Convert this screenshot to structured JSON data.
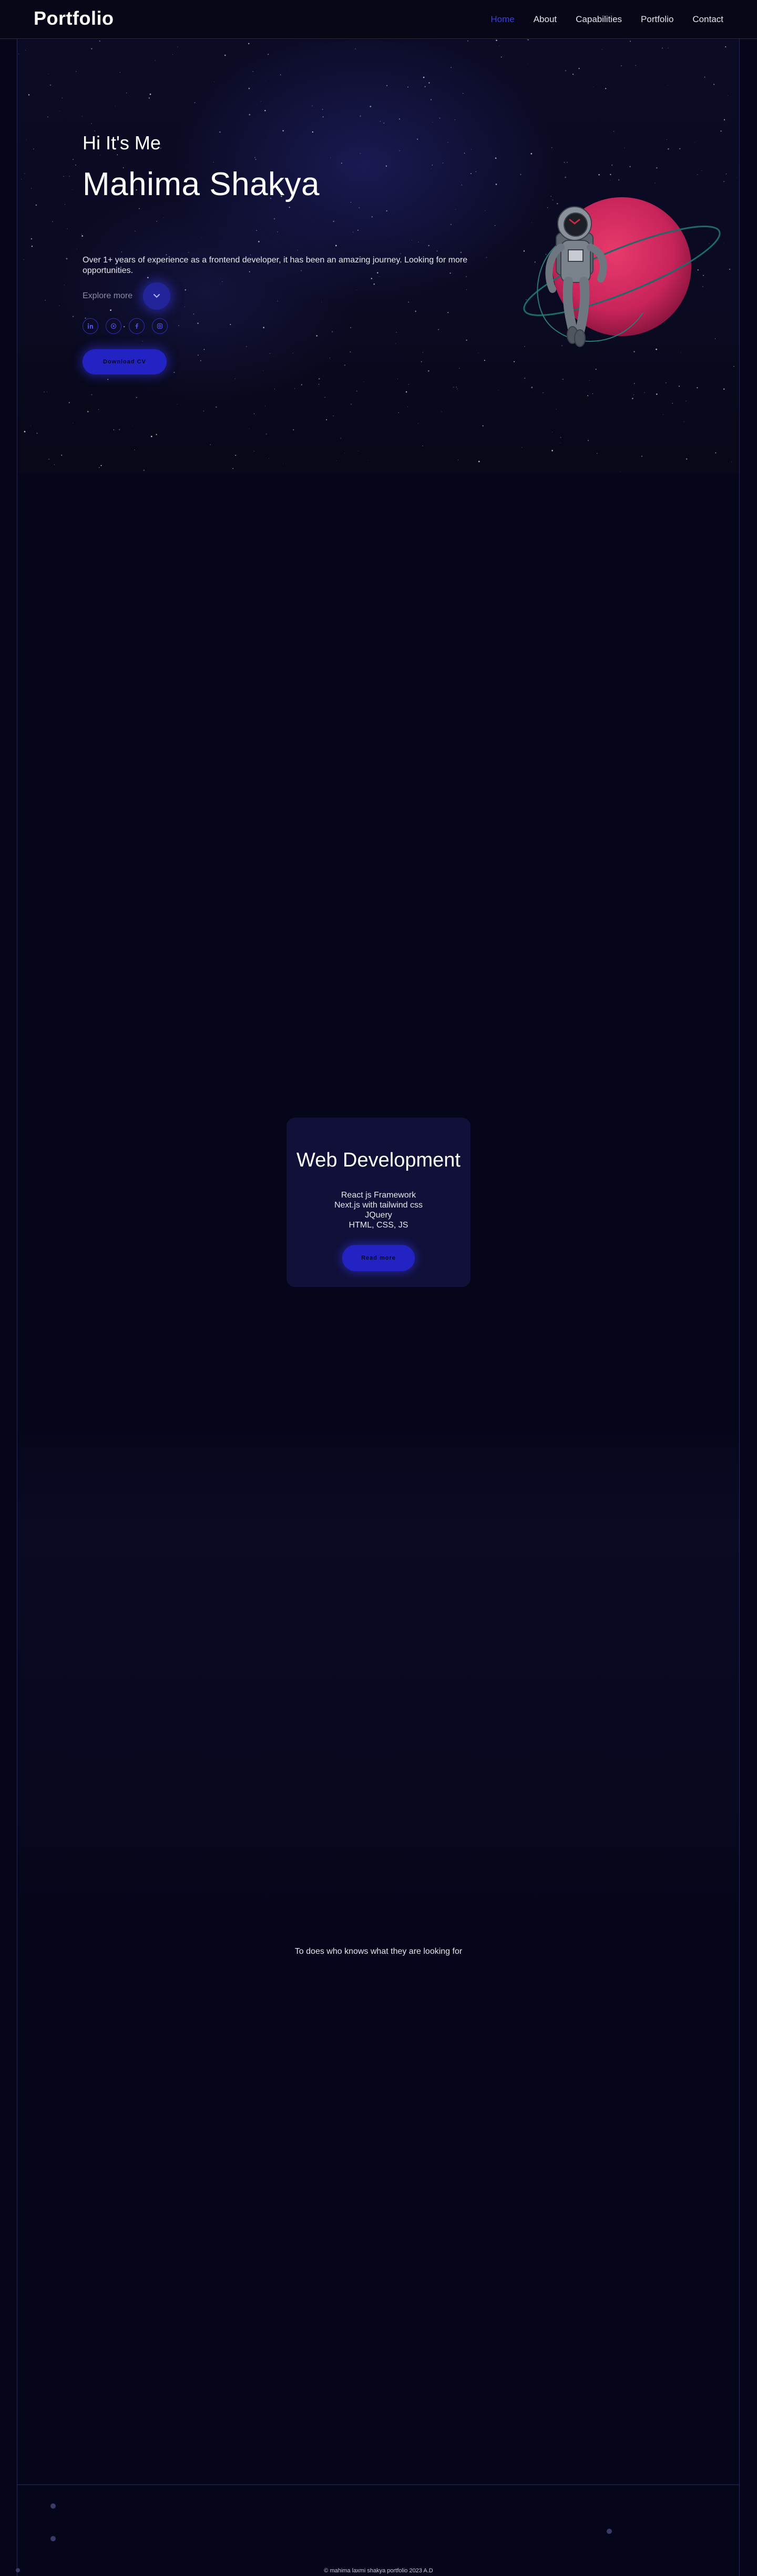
{
  "navbar": {
    "brand": "Portfolio",
    "links": [
      "Home",
      "About",
      "Capabilities",
      "Portfolio",
      "Contact"
    ],
    "active_link": "Home"
  },
  "hero": {
    "greeting": "Hi It's Me",
    "name": "Mahima Shakya",
    "description": "Over 1+ years of experience as a frontend developer, it has been an amazing journey. Looking for more opportunities.",
    "explore_label": "Explore more",
    "socials": [
      "linkedin-icon",
      "github-icon",
      "facebook-icon",
      "instagram-icon"
    ],
    "download_label": "Download CV"
  },
  "capabilities": {
    "title": "Web Development",
    "items": [
      "React js Framework",
      "Next.js with tailwind css",
      "JQuery",
      "HTML, CSS, JS"
    ],
    "button_label": "Read more"
  },
  "portfolio": {
    "tagline": "To does who knows what they are looking for"
  },
  "footer": {
    "copyright": "© mahima laxmi shakya portfolio 2023 A.D"
  },
  "colors": {
    "background": "#06061a",
    "accent": "#2323c4",
    "active_link": "#3b3bf5",
    "planet": "#d42a5e"
  }
}
